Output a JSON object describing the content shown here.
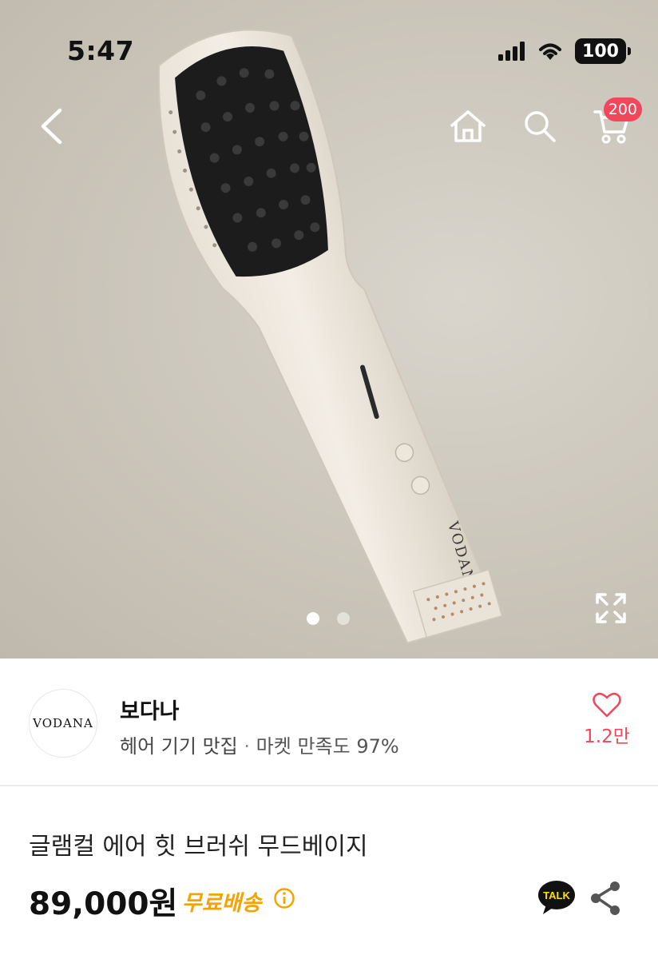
{
  "status_bar": {
    "time": "5:47",
    "battery": "100"
  },
  "nav": {
    "cart_count": "200"
  },
  "colors": {
    "accent": "#f0475b",
    "shipping": "#f5a300",
    "kakao": "#fae100"
  },
  "hero": {
    "product_brand_print": "VODANA",
    "slide_count": 2,
    "active_slide": 1
  },
  "seller": {
    "logo_text": "VODANA",
    "name": "보다나",
    "tagline": "헤어 기기 맛집",
    "separator": "·",
    "satisfaction": "마켓 만족도 97%",
    "likes": "1.2만"
  },
  "product": {
    "title": "글램컬 에어 힛 브러쉬 무드베이지",
    "price": "89,000원",
    "shipping": "무료배송",
    "talk_label": "TALK"
  },
  "icons": [
    "back-icon",
    "home-icon",
    "search-icon",
    "cart-icon",
    "expand-icon",
    "heart-icon",
    "info-icon",
    "kakao-talk-icon",
    "share-icon"
  ]
}
